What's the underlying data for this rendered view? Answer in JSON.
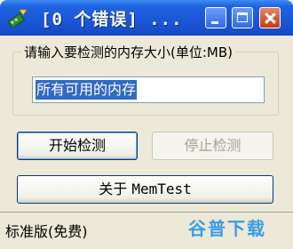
{
  "window": {
    "title": "[0 个错误] ..."
  },
  "group": {
    "legend": "请输入要检测的内存大小(单位:MB)"
  },
  "size_input": {
    "value": "所有可用的内存"
  },
  "buttons": {
    "start": "开始检测",
    "stop": "停止检测",
    "about_prefix": "关于 ",
    "about_app": "MemTest"
  },
  "status": {
    "text": "标准版(免费)"
  },
  "watermark": {
    "text": "谷普下载"
  }
}
